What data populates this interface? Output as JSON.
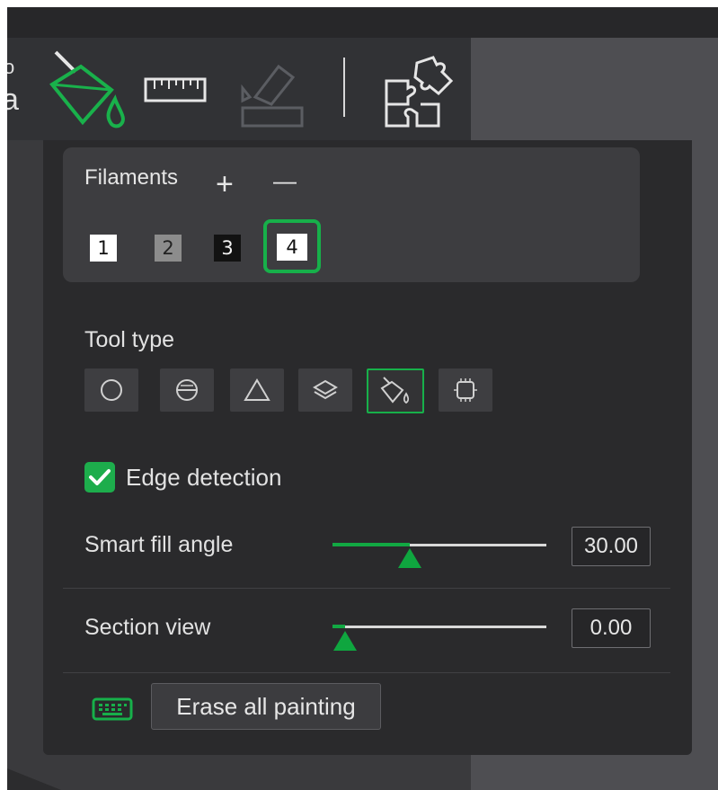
{
  "toolbar": {
    "icons": [
      "partial-text-icon",
      "paint-bucket-icon",
      "ruler-icon",
      "assembly-icon",
      "puzzle-icon"
    ],
    "partial_glyph_top": "o",
    "partial_glyph_bottom": "a"
  },
  "filaments": {
    "title": "Filaments",
    "add_label": "+",
    "remove_label": "—",
    "swatches": [
      {
        "label": "1",
        "color": "#ffffff",
        "text_color": "#111111"
      },
      {
        "label": "2",
        "color": "#8c8c8c",
        "text_color": "#222222"
      },
      {
        "label": "3",
        "color": "#121212",
        "text_color": "#f2f2f2"
      },
      {
        "label": "4",
        "color": "#ffffff",
        "text_color": "#111111",
        "selected": true
      }
    ]
  },
  "tool_type": {
    "label": "Tool type",
    "tools": [
      "circle-tool-icon",
      "sphere-tool-icon",
      "triangle-tool-icon",
      "layers-tool-icon",
      "fill-bucket-tool-icon",
      "gap-fill-tool-icon"
    ],
    "active_index": 4
  },
  "edge_detection": {
    "label": "Edge detection",
    "checked": true
  },
  "smart_fill": {
    "label": "Smart fill angle",
    "value": "30.00",
    "fraction": 0.36
  },
  "section_view": {
    "label": "Section view",
    "value": "0.00",
    "fraction": 0.0
  },
  "erase": {
    "label": "Erase all painting"
  },
  "colors": {
    "accent": "#17b04a",
    "panel": "#2a2a2c",
    "box": "#3d3d40"
  }
}
